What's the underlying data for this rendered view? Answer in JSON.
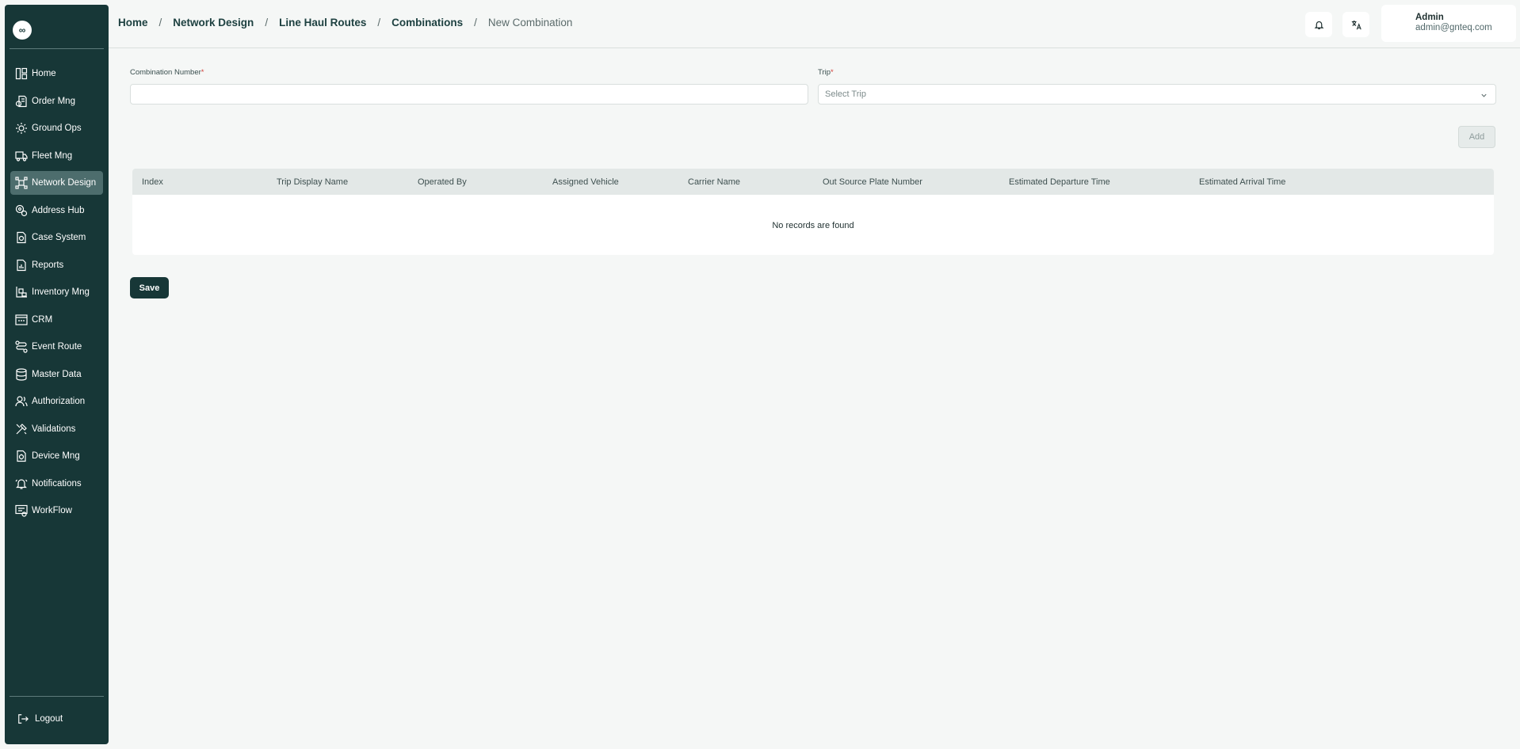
{
  "sidebar": {
    "logo": "∞",
    "items": [
      {
        "label": "Home",
        "icon": "home-icon",
        "active": false
      },
      {
        "label": "Order Mng",
        "icon": "order-icon",
        "active": false
      },
      {
        "label": "Ground Ops",
        "icon": "ground-ops-icon",
        "active": false
      },
      {
        "label": "Fleet Mng",
        "icon": "truck-icon",
        "active": false
      },
      {
        "label": "Network Design",
        "icon": "network-icon",
        "active": true
      },
      {
        "label": "Address Hub",
        "icon": "address-icon",
        "active": false
      },
      {
        "label": "Case System",
        "icon": "case-icon",
        "active": false
      },
      {
        "label": "Reports",
        "icon": "reports-icon",
        "active": false
      },
      {
        "label": "Inventory Mng",
        "icon": "inventory-icon",
        "active": false
      },
      {
        "label": "CRM",
        "icon": "crm-icon",
        "active": false
      },
      {
        "label": "Event Route",
        "icon": "route-icon",
        "active": false
      },
      {
        "label": "Master Data",
        "icon": "database-icon",
        "active": false
      },
      {
        "label": "Authorization",
        "icon": "users-icon",
        "active": false
      },
      {
        "label": "Validations",
        "icon": "tools-icon",
        "active": false
      },
      {
        "label": "Device Mng",
        "icon": "device-icon",
        "active": false
      },
      {
        "label": "Notifications",
        "icon": "bell-icon",
        "active": false
      },
      {
        "label": "WorkFlow",
        "icon": "workflow-icon",
        "active": false
      }
    ],
    "logout": "Logout"
  },
  "breadcrumb": {
    "items": [
      "Home",
      "Network Design",
      "Line Haul Routes",
      "Combinations"
    ],
    "current": "New Combination",
    "separator": "/"
  },
  "user": {
    "name": "Admin",
    "email": "admin@gnteq.com"
  },
  "form": {
    "combination_number": {
      "label": "Combination Number",
      "value": "",
      "required_mark": "*"
    },
    "trip": {
      "label": "Trip",
      "placeholder": "Select Trip",
      "required_mark": "*"
    }
  },
  "add_label": "Add",
  "table": {
    "columns": [
      "Index",
      "Trip Display Name",
      "Operated By",
      "Assigned Vehicle",
      "Carrier Name",
      "Out Source Plate Number",
      "Estimated Departure Time",
      "Estimated Arrival Time"
    ],
    "empty_text": "No records are found"
  },
  "save_label": "Save",
  "colors": {
    "sidebar_bg": "#173737",
    "active_item": "#4d6d6d",
    "primary_button": "#173737",
    "required": "#d3423c"
  }
}
